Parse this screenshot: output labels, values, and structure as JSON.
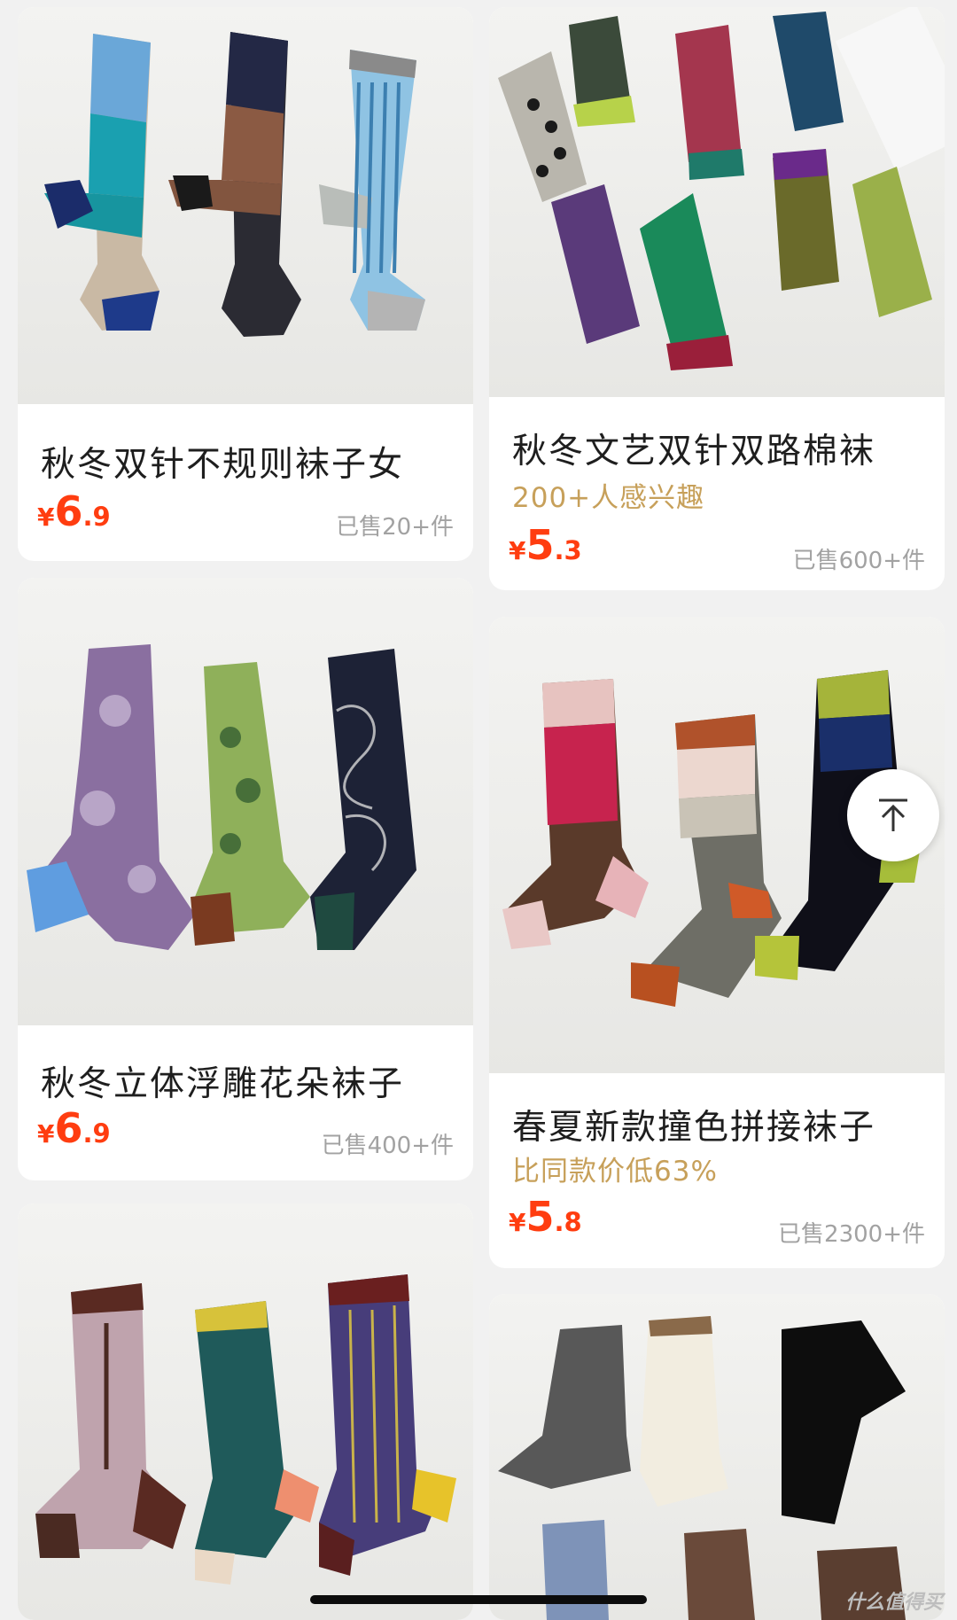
{
  "products": [
    {
      "title": "秋冬双针不规则袜子女",
      "tag": "",
      "price": {
        "currency": "¥",
        "integer": "6",
        "decimal": ".9"
      },
      "sold": "已售20+件",
      "image": "three-patterned-crew-socks"
    },
    {
      "title": "秋冬文艺双针双路棉袜",
      "tag": "200+人感兴趣",
      "price": {
        "currency": "¥",
        "integer": "5",
        "decimal": ".3"
      },
      "sold": "已售600+件",
      "image": "eight-jacquard-socks"
    },
    {
      "title": "秋冬立体浮雕花朵袜子",
      "tag": "",
      "price": {
        "currency": "¥",
        "integer": "6",
        "decimal": ".9"
      },
      "sold": "已售400+件",
      "image": "three-floral-socks"
    },
    {
      "title": "春夏新款撞色拼接袜子",
      "tag": "比同款价低63%",
      "price": {
        "currency": "¥",
        "integer": "5",
        "decimal": ".8"
      },
      "sold": "已售2300+件",
      "image": "three-color-block-socks"
    },
    {
      "title": "",
      "tag": "",
      "price": {
        "currency": "",
        "integer": "",
        "decimal": ""
      },
      "sold": "",
      "image": "three-vintage-socks"
    },
    {
      "title": "",
      "tag": "",
      "price": {
        "currency": "",
        "integer": "",
        "decimal": ""
      },
      "sold": "",
      "image": "solid-rolled-cuff-socks"
    }
  ],
  "back_to_top": {
    "icon": "arrow-up-to-top-icon"
  },
  "watermark": "什么值得买",
  "colors": {
    "price": "#ff3d10",
    "tag": "#c7a05a",
    "sold": "#a2a2a2",
    "background": "#f1f1f1"
  }
}
